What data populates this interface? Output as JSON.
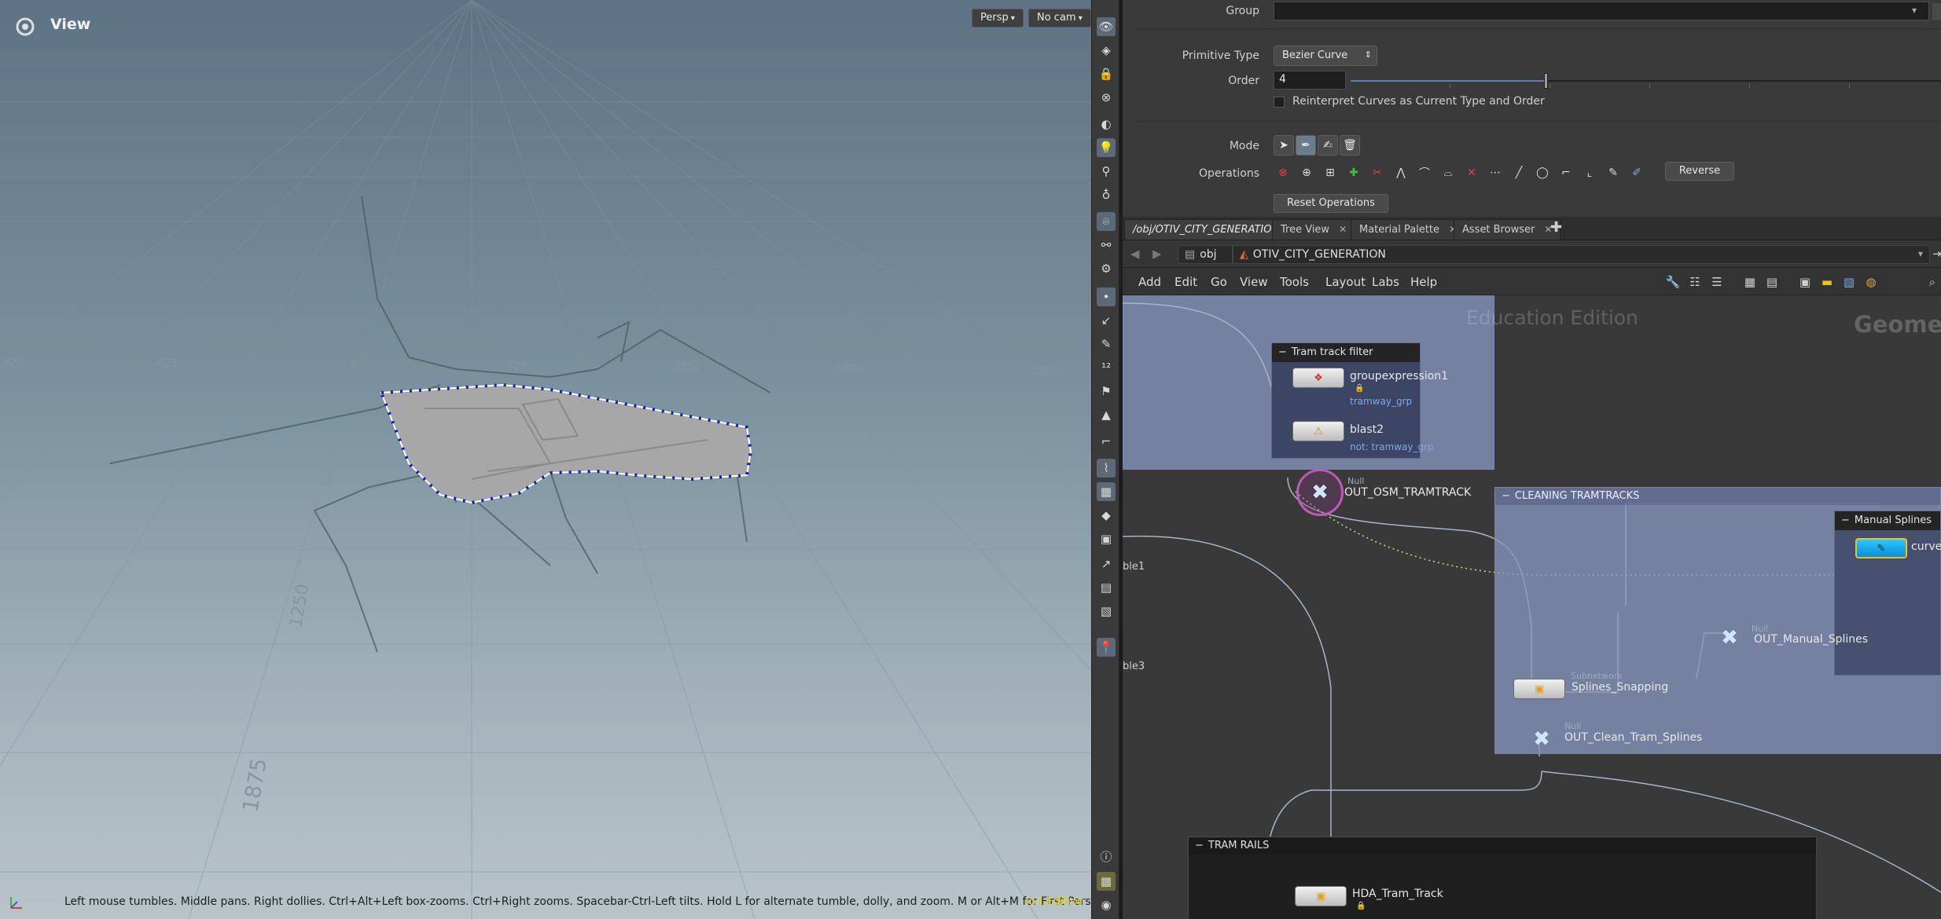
{
  "viewport": {
    "title": "View",
    "persp_label": "Persp",
    "cam_label": "No cam",
    "status": "Left mouse tumbles. Middle pans. Right dollies. Ctrl+Alt+Left box-zooms. Ctrl+Right zooms. Spacebar-Ctrl-Left tilts. Hold L for alternate tumble, dolly, and zoom. M or Alt+M for First Person Navigation.",
    "status_edition": "ion Edition",
    "grid_labels": [
      "-625",
      "0",
      "625",
      "1250",
      "1875",
      "2500",
      "625",
      "1250",
      "1875",
      "-625"
    ]
  },
  "params": {
    "group_label": "Group",
    "group_value": "",
    "primitive_type_label": "Primitive Type",
    "primitive_type_value": "Bezier Curve",
    "order_label": "Order",
    "order_value": "4",
    "order_slider": 0.33,
    "reinterpret_label": "Reinterpret Curves as Current Type and Order",
    "mode_label": "Mode",
    "operations_label": "Operations",
    "reverse_label": "Reverse",
    "reset_label": "Reset Operations"
  },
  "tabs": [
    {
      "label": "/obj/OTIV_CITY_GENERATION",
      "active": true
    },
    {
      "label": "Tree View",
      "active": false
    },
    {
      "label": "Material Palette",
      "active": false
    },
    {
      "label": "Asset Browser",
      "active": false
    }
  ],
  "path": {
    "obj": "obj",
    "network": "OTIV_CITY_GENERATION"
  },
  "menu": [
    "Add",
    "Edit",
    "Go",
    "View",
    "Tools",
    "Layout",
    "Labs",
    "Help"
  ],
  "network": {
    "watermark_edition": "Education Edition",
    "watermark_context": "Geomet",
    "box_tram_filter": "Tram track filter",
    "box_cleaning": "CLEANING TRAMTRACKS",
    "box_manual": "Manual Splines",
    "box_rails": "TRAM RAILS",
    "node_groupexpression": "groupexpression1",
    "node_groupexpression_sub": "tramway_grp",
    "node_blast": "blast2",
    "node_blast_sub": "not: tramway_grp",
    "node_out_osm_type": "Null",
    "node_out_osm": "OUT_OSM_TRAMTRACK",
    "node_out_manual_type": "Null",
    "node_out_manual": "OUT_Manual_Splines",
    "node_snapping_type": "Subnetwork",
    "node_snapping": "Splines_Snapping",
    "node_out_clean_type": "Null",
    "node_out_clean": "OUT_Clean_Tram_Splines",
    "node_curve": "curve",
    "node_hda": "HDA_Tram_Track",
    "cut_label_1": "ble1",
    "cut_label_2": "ble3"
  },
  "colors": {
    "accent_blue": "#7da7e8",
    "selection_yellow": "#f0c020",
    "null_ring": "#c05ab8",
    "netbox_blue": "#8796be"
  }
}
